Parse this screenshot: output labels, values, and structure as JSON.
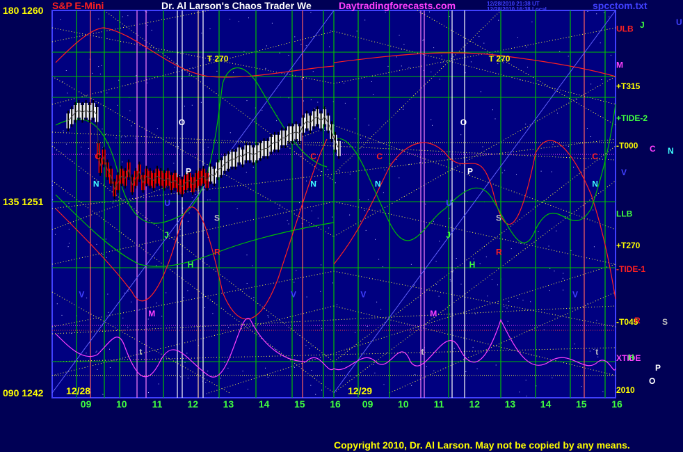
{
  "header": {
    "symbol": "S&P E-Mini",
    "title": "Dr. Al Larson's Chaos Trader We",
    "site": "Daytradingforecasts.com",
    "stamp1": "12/28/2010 21:38 UT",
    "stamp2": "12/28/2010 16:38 Local",
    "file": "spcctom.txt"
  },
  "left_axis": [
    {
      "angle": "180",
      "price": "1260",
      "value": 1260
    },
    {
      "angle": "135",
      "price": "1251",
      "value": 1251
    },
    {
      "angle": "090",
      "price": "1242",
      "value": 1242
    }
  ],
  "right_labels": [
    {
      "text": "ULB",
      "color": "#ff2020",
      "y": 1259
    },
    {
      "text": "M",
      "color": "#ff40ff",
      "y": 1257.3
    },
    {
      "text": "+T315",
      "color": "#ffff00",
      "y": 1256.3
    },
    {
      "text": "+TIDE-2",
      "color": "#40ff40",
      "y": 1254.8
    },
    {
      "text": "-T000",
      "color": "#ffff00",
      "y": 1253.5
    },
    {
      "text": "LLB",
      "color": "#40ff40",
      "y": 1250.3
    },
    {
      "text": "+T270",
      "color": "#ffff00",
      "y": 1248.8
    },
    {
      "text": "-TIDE-1",
      "color": "#ff2020",
      "y": 1247.7
    },
    {
      "text": "-T045",
      "color": "#ffff00",
      "y": 1245.2
    },
    {
      "text": "XTIDE",
      "color": "#ff40ff",
      "y": 1243.5
    },
    {
      "text": "2010",
      "color": "#ffff00",
      "y": 1242
    }
  ],
  "far_right_markers": [
    {
      "text": "J",
      "color": "#40ff40"
    },
    {
      "text": "U",
      "color": "#4040ff"
    },
    {
      "text": "C",
      "color": "#ff40ff"
    },
    {
      "text": "N",
      "color": "#40ffff"
    },
    {
      "text": "V",
      "color": "#4040ff"
    },
    {
      "text": "R",
      "color": "#ff2020"
    },
    {
      "text": "S",
      "color": "#c0c0c0"
    },
    {
      "text": "H",
      "color": "#40ff40"
    },
    {
      "text": "P",
      "color": "#ffffff"
    },
    {
      "text": "O",
      "color": "#ffffff"
    }
  ],
  "planet_markers": [
    {
      "text": "C",
      "color": "#ff2020",
      "day": 1,
      "t": 9.25,
      "y": 1253.0
    },
    {
      "text": "N",
      "color": "#40ffff",
      "day": 1,
      "t": 9.2,
      "y": 1251.7
    },
    {
      "text": "O",
      "color": "#ffffff",
      "day": 1,
      "t": 11.6,
      "y": 1254.6
    },
    {
      "text": "P",
      "color": "#ffffff",
      "day": 1,
      "t": 11.8,
      "y": 1252.3
    },
    {
      "text": "T  270",
      "color": "#ffff00",
      "day": 1,
      "t": 12.4,
      "y": 1257.6
    },
    {
      "text": "U",
      "color": "#4040ff",
      "day": 1,
      "t": 11.2,
      "y": 1250.8
    },
    {
      "text": "J",
      "color": "#40ff40",
      "day": 1,
      "t": 11.2,
      "y": 1249.3
    },
    {
      "text": "S",
      "color": "#c0c0c0",
      "day": 1,
      "t": 12.6,
      "y": 1250.1
    },
    {
      "text": "R",
      "color": "#ff2020",
      "day": 1,
      "t": 12.6,
      "y": 1248.5
    },
    {
      "text": "H",
      "color": "#40ff40",
      "day": 1,
      "t": 11.85,
      "y": 1247.9
    },
    {
      "text": "V",
      "color": "#4040ff",
      "day": 1,
      "t": 8.8,
      "y": 1246.5
    },
    {
      "text": "M",
      "color": "#ff40ff",
      "day": 1,
      "t": 10.75,
      "y": 1245.6
    },
    {
      "text": "t",
      "color": "#c0c0c0",
      "day": 1,
      "t": 10.5,
      "y": 1243.8
    },
    {
      "text": "C",
      "color": "#ff2020",
      "day": 1,
      "t": 15.3,
      "y": 1253.0
    },
    {
      "text": "N",
      "color": "#40ffff",
      "day": 1,
      "t": 15.3,
      "y": 1251.7
    },
    {
      "text": "V",
      "color": "#4040ff",
      "day": 1,
      "t": 14.75,
      "y": 1246.5
    },
    {
      "text": "C",
      "color": "#ff2020",
      "day": 2,
      "t": 9.25,
      "y": 1253.0
    },
    {
      "text": "N",
      "color": "#40ffff",
      "day": 2,
      "t": 9.2,
      "y": 1251.7
    },
    {
      "text": "O",
      "color": "#ffffff",
      "day": 2,
      "t": 11.6,
      "y": 1254.6
    },
    {
      "text": "P",
      "color": "#ffffff",
      "day": 2,
      "t": 11.8,
      "y": 1252.3
    },
    {
      "text": "T  270",
      "color": "#ffff00",
      "day": 2,
      "t": 12.4,
      "y": 1257.6
    },
    {
      "text": "U",
      "color": "#4040ff",
      "day": 2,
      "t": 11.2,
      "y": 1250.8
    },
    {
      "text": "J",
      "color": "#40ff40",
      "day": 2,
      "t": 11.2,
      "y": 1249.3
    },
    {
      "text": "S",
      "color": "#c0c0c0",
      "day": 2,
      "t": 12.6,
      "y": 1250.1
    },
    {
      "text": "R",
      "color": "#ff2020",
      "day": 2,
      "t": 12.6,
      "y": 1248.5
    },
    {
      "text": "H",
      "color": "#40ff40",
      "day": 2,
      "t": 11.85,
      "y": 1247.9
    },
    {
      "text": "V",
      "color": "#4040ff",
      "day": 2,
      "t": 8.8,
      "y": 1246.5
    },
    {
      "text": "M",
      "color": "#ff40ff",
      "day": 2,
      "t": 10.75,
      "y": 1245.6
    },
    {
      "text": "t",
      "color": "#c0c0c0",
      "day": 2,
      "t": 10.5,
      "y": 1243.8
    },
    {
      "text": "C",
      "color": "#ff2020",
      "day": 2,
      "t": 15.3,
      "y": 1253.0
    },
    {
      "text": "N",
      "color": "#40ffff",
      "day": 2,
      "t": 15.3,
      "y": 1251.7
    },
    {
      "text": "V",
      "color": "#4040ff",
      "day": 2,
      "t": 14.75,
      "y": 1246.5
    },
    {
      "text": "t",
      "color": "#c0c0c0",
      "day": 2,
      "t": 15.4,
      "y": 1243.8
    }
  ],
  "date_labels": [
    {
      "text": "12/28",
      "day": 1
    },
    {
      "text": "12/29",
      "day": 2
    }
  ],
  "footer": {
    "copyright": "Copyright 2010, Dr. Al Larson. May not be copied by any means."
  },
  "colors": {
    "background": "#000055",
    "plot_background": "#000080",
    "grid_green": "#00c000",
    "grid_yellow": "#ffff40",
    "price_white": "#ffffff",
    "price_red": "#ff0000",
    "axis_border": "#4040ff"
  },
  "chart_data": {
    "type": "line",
    "title": "S&P E-Mini",
    "x_ticks_hours": [
      "09",
      "10",
      "11",
      "12",
      "13",
      "14",
      "15",
      "16"
    ],
    "days": [
      "12/28",
      "12/29"
    ],
    "ylim": [
      1242,
      1260
    ],
    "price_bars": {
      "hours": [
        8.5,
        8.6,
        8.7,
        8.8,
        8.9,
        9.0,
        9.1,
        9.2,
        9.3,
        9.35,
        9.4,
        9.5,
        9.6,
        9.7,
        9.8,
        9.9,
        10.0,
        10.1,
        10.2,
        10.3,
        10.4,
        10.5,
        10.6,
        10.7,
        10.8,
        10.9,
        11.0,
        11.1,
        11.2,
        11.3,
        11.4,
        11.5,
        11.6,
        11.7,
        11.8,
        11.9,
        12.0,
        12.1,
        12.2,
        12.3,
        12.4,
        12.5,
        12.6,
        12.7,
        12.8,
        12.9,
        13.0,
        13.1,
        13.2,
        13.3,
        13.4,
        13.5,
        13.6,
        13.7,
        13.8,
        13.9,
        14.0,
        14.1,
        14.2,
        14.3,
        14.4,
        14.5,
        14.6,
        14.7,
        14.8,
        14.9,
        15.0,
        15.1,
        15.2,
        15.3,
        15.4,
        15.5,
        15.6,
        15.7,
        15.8,
        15.9,
        16.0,
        16.1
      ],
      "close": [
        1254.8,
        1255.0,
        1255.2,
        1255.3,
        1255.2,
        1255.3,
        1255.2,
        1255.3,
        1255.1,
        1253.4,
        1252.7,
        1253.1,
        1252.5,
        1252.2,
        1251.6,
        1251.9,
        1252.2,
        1252.1,
        1252.5,
        1251.8,
        1252.1,
        1252.4,
        1251.9,
        1252.2,
        1252.1,
        1252.0,
        1252.2,
        1252.1,
        1252.0,
        1252.1,
        1251.9,
        1252.0,
        1251.8,
        1251.7,
        1251.9,
        1252.0,
        1251.8,
        1252.0,
        1252.1,
        1252.2,
        1252.0,
        1252.3,
        1252.2,
        1252.5,
        1252.6,
        1252.8,
        1252.9,
        1253.0,
        1253.0,
        1253.2,
        1253.1,
        1253.3,
        1253.3,
        1253.2,
        1253.3,
        1253.4,
        1253.5,
        1253.5,
        1253.7,
        1253.8,
        1253.8,
        1254.0,
        1254.0,
        1254.2,
        1254.2,
        1254.3,
        1254.2,
        1254.6,
        1254.8,
        1254.7,
        1254.9,
        1255.0,
        1254.8,
        1255.0,
        1254.7,
        1254.3,
        1253.8,
        1253.5
      ],
      "down_segment_hours": [
        9.35,
        12.4
      ]
    }
  }
}
